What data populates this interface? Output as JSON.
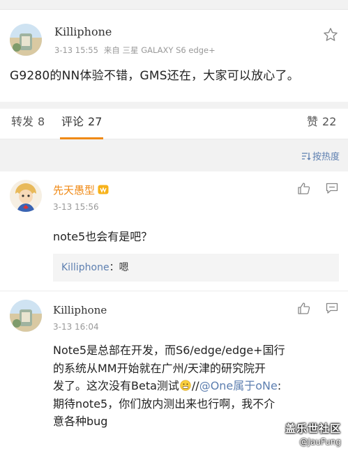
{
  "post": {
    "author": "Killiphone",
    "time": "3-13 15:55",
    "source": "来自 三星 GALAXY S6 edge+",
    "text": "G9280的NN体验不错，GMS还在，大家可以放心了。",
    "icons": {
      "avatar": "landscape-avatar",
      "favorite": "star-icon"
    }
  },
  "tabs": {
    "repost": {
      "label": "转发",
      "count": "8"
    },
    "comment": {
      "label": "评论",
      "count": "27"
    },
    "like": {
      "label": "赞",
      "count": "22"
    },
    "active_color": "#f08a16"
  },
  "sort": {
    "label": "按热度",
    "icon": "sort-icon"
  },
  "comments": [
    {
      "author": "先天愚型",
      "author_color": "#f08a16",
      "badge": "vip-icon",
      "time": "3-13 15:56",
      "text": "note5也会有是吧？",
      "reply": {
        "user": "Killiphone",
        "separator": "：",
        "text": "嗯"
      },
      "icons": {
        "like": "thumbs-up-icon",
        "reply": "comment-icon"
      }
    },
    {
      "author": "Killiphone",
      "time": "3-13 16:04",
      "lines": {
        "l1": "Note5是总部在开发，而S6/edge/edge+国行",
        "l2": "的系统从MM开始就在广州/天津的研究院开",
        "l3a": "发了。这次没有Beta测试",
        "l3b": "//",
        "mention": "@One属于oNe",
        "l3c": ":",
        "l4": "期待note5，你们放内测出来也行啊，我不介",
        "l5": "意各种bug"
      },
      "emoji": "grimace-emoji",
      "icons": {
        "like": "thumbs-up-icon",
        "reply": "comment-icon"
      }
    }
  ],
  "watermark": {
    "logo": "盖乐世社区",
    "user": "@JauFung"
  },
  "colors": {
    "link": "#5d7fb0",
    "accent": "#f08a16",
    "divider": "#f2f2f2"
  }
}
